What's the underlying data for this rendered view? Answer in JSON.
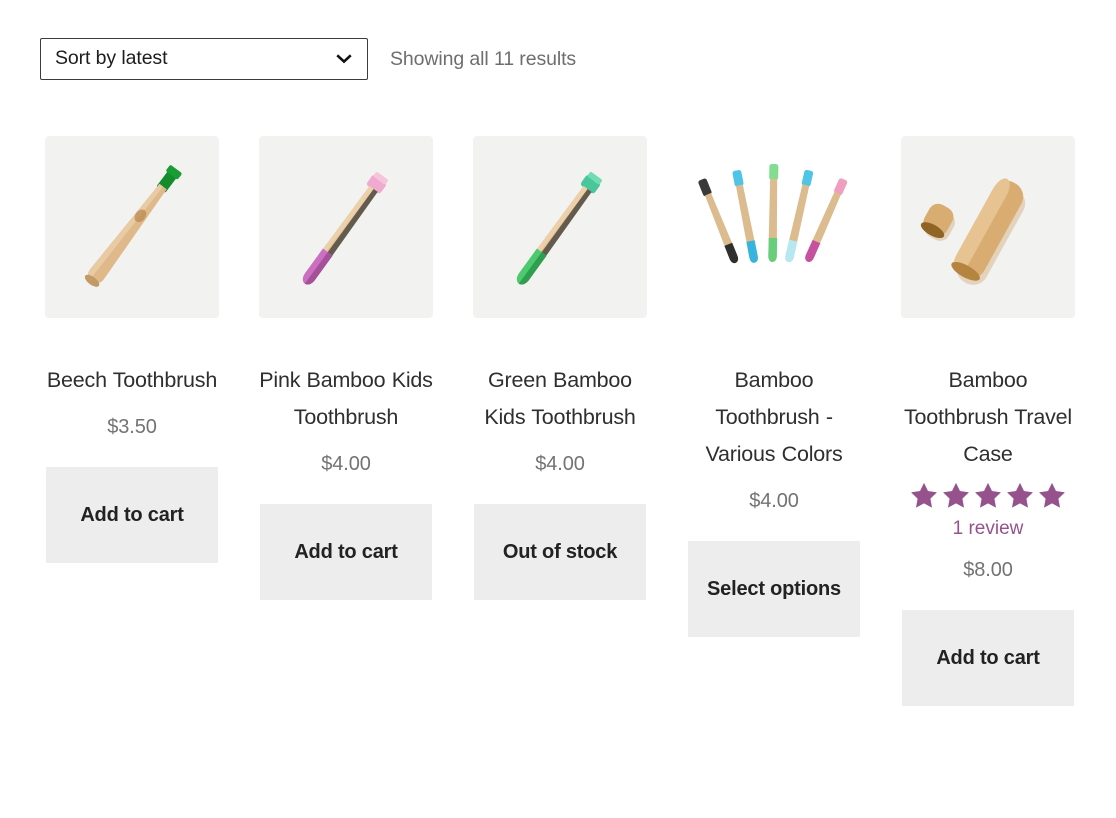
{
  "toolbar": {
    "sort_value": "Sort by latest",
    "sort_options": [
      "Sort by latest"
    ],
    "chevron_icon": "chevron-down-icon",
    "results_text": "Showing all 11 results"
  },
  "theme": {
    "accent_purple": "#95528c",
    "button_bg": "#ededed",
    "thumb_bg": "#f2f2f1",
    "muted_text": "#737373"
  },
  "products": [
    {
      "title": "Beech Toothbrush",
      "price": "$3.50",
      "cta": "Add to cart",
      "image_name": "beech-toothbrush-image",
      "thumb_style": "gray",
      "rating": null,
      "review_text": null
    },
    {
      "title": "Pink Bamboo Kids Toothbrush",
      "price": "$4.00",
      "cta": "Add to cart",
      "image_name": "pink-bamboo-kids-toothbrush-image",
      "thumb_style": "gray",
      "rating": null,
      "review_text": null
    },
    {
      "title": "Green Bamboo Kids Toothbrush",
      "price": "$4.00",
      "cta": "Out of stock",
      "image_name": "green-bamboo-kids-toothbrush-image",
      "thumb_style": "gray",
      "rating": null,
      "review_text": null
    },
    {
      "title": "Bamboo Toothbrush - Various Colors",
      "price": "$4.00",
      "cta": "Select options",
      "image_name": "bamboo-toothbrush-various-colors-image",
      "thumb_style": "white",
      "rating": null,
      "review_text": null
    },
    {
      "title": "Bamboo Toothbrush Travel Case",
      "price": "$8.00",
      "cta": "Add to cart",
      "image_name": "bamboo-toothbrush-travel-case-image",
      "thumb_style": "gray",
      "rating": 5,
      "review_text": "1 review"
    }
  ]
}
